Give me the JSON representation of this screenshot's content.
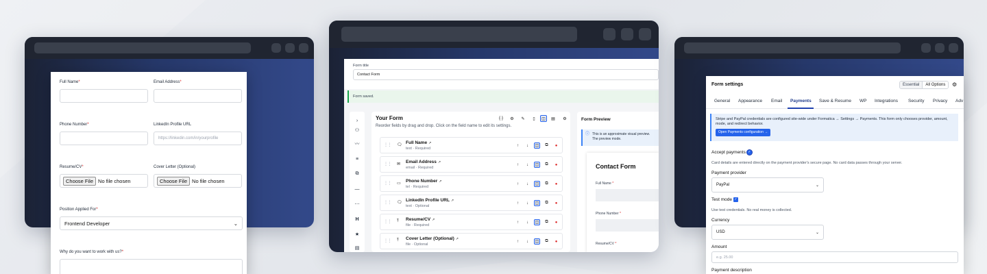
{
  "left_form": {
    "full_name_label": "Full Name",
    "email_label": "Email Address",
    "phone_label": "Phone Number",
    "linkedin_label": "LinkedIn Profile URL",
    "linkedin_placeholder": "https://linkedin.com/in/yourprofile",
    "resume_label": "Resume/CV",
    "cover_label": "Cover Letter (Optional)",
    "choose_file": "Choose File",
    "no_file": "No file chosen",
    "position_label": "Position Applied For",
    "position_value": "Frontend Developer",
    "why_label": "Why do you want to work with us?",
    "required_mark": "*"
  },
  "middle": {
    "form_title_label": "Form title",
    "form_title_value": "Contact Form",
    "saved_msg": "Form saved.",
    "your_form_title": "Your Form",
    "your_form_sub": "Reorder fields by drag and drop. Click on the field name to edit its settings.",
    "fields": [
      {
        "name": "Full Name",
        "meta": "text · Required",
        "icon": "🗨"
      },
      {
        "name": "Email Address",
        "meta": "email · Required",
        "icon": "✉"
      },
      {
        "name": "Phone Number",
        "meta": "tel · Required",
        "icon": "▭"
      },
      {
        "name": "LinkedIn Profile URL",
        "meta": "text · Optional",
        "icon": "🗨"
      },
      {
        "name": "Resume/CV",
        "meta": "file · Required",
        "icon": "⤒"
      },
      {
        "name": "Cover Letter (Optional)",
        "meta": "file · Optional",
        "icon": "⤒"
      }
    ],
    "preview_title": "Form Preview",
    "preview_note": "This is an approximate visual preview. The preview mode.",
    "preview_form_title": "Contact Form",
    "preview_full_name": "Full Name",
    "preview_phone": "Phone Number",
    "preview_resume": "Resume/CV",
    "required_mark": "*"
  },
  "right": {
    "title": "Form settings",
    "toggle_essential": "Essential",
    "toggle_all": "All Options",
    "tabs": [
      "General",
      "Appearance",
      "Email",
      "Payments",
      "Save & Resume",
      "WP",
      "Integrations",
      "Security",
      "Privacy",
      "Adv"
    ],
    "active_tab": "Payments",
    "info_text": "Stripe and PayPal credentials are configured site-wide under Formatica → Settings → Payments. This form only chooses provider, amount, mode, and redirect behavior.",
    "info_button": "Open Payments configuration →",
    "accept_payments": "Accept payments",
    "card_note": "Card details are entered directly on the payment provider's secure page. No card data passes through your server.",
    "provider_label": "Payment provider",
    "provider_value": "PayPal",
    "test_mode": "Test mode",
    "test_note": "Use test credentials. No real money is collected.",
    "currency_label": "Currency",
    "currency_value": "USD",
    "amount_label": "Amount",
    "amount_placeholder": "e.g. 25.00",
    "description_label": "Payment description"
  }
}
